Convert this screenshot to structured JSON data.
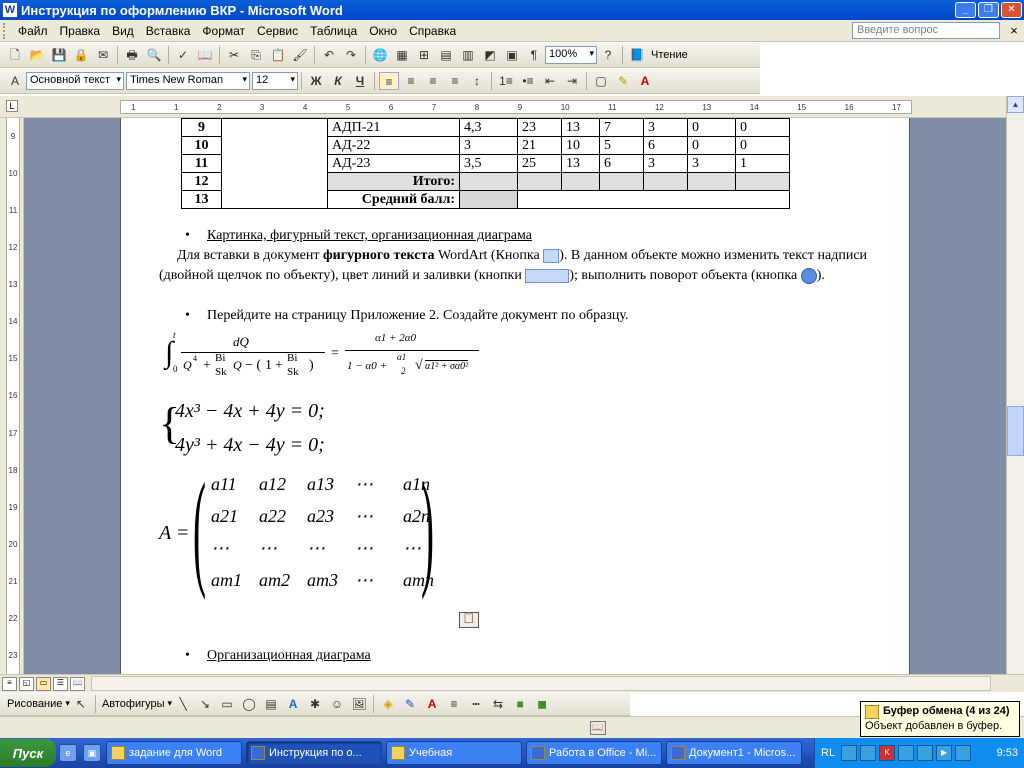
{
  "window": {
    "title": "Инструкция по оформлению ВКР - Microsoft Word",
    "app_icon": "W"
  },
  "menu": {
    "items": [
      "Файл",
      "Правка",
      "Вид",
      "Вставка",
      "Формат",
      "Сервис",
      "Таблица",
      "Окно",
      "Справка"
    ],
    "ask_placeholder": "Введите вопрос",
    "close_doc": "×"
  },
  "toolbar_standard": {
    "zoom": "100%",
    "reading_label": "Чтение"
  },
  "toolbar_format": {
    "style": "Основной текст",
    "font": "Times New Roman",
    "size": "12",
    "bold": "Ж",
    "italic": "К",
    "underline": "Ч"
  },
  "ruler": {
    "h_ticks": [
      "1",
      "1",
      "2",
      "3",
      "4",
      "5",
      "6",
      "7",
      "8",
      "9",
      "10",
      "11",
      "12",
      "13",
      "14",
      "15",
      "16",
      "17"
    ],
    "v_ticks": [
      "9",
      "10",
      "11",
      "12",
      "13",
      "14",
      "15",
      "16",
      "17",
      "18",
      "19",
      "20",
      "21",
      "22",
      "23"
    ]
  },
  "table": {
    "rows": [
      {
        "num": "9",
        "col2": "",
        "group": "АДП-21",
        "v1": "4,3",
        "v2": "23",
        "v3": "13",
        "v4": "7",
        "v5": "3",
        "v6": "0",
        "v7": "0"
      },
      {
        "num": "10",
        "col2": "",
        "group": "АД-22",
        "v1": "3",
        "v2": "21",
        "v3": "10",
        "v4": "5",
        "v5": "6",
        "v6": "0",
        "v7": "0"
      },
      {
        "num": "11",
        "col2": "",
        "group": "АД-23",
        "v1": "3,5",
        "v2": "25",
        "v3": "13",
        "v4": "6",
        "v5": "3",
        "v6": "3",
        "v7": "1"
      }
    ],
    "total_num": "12",
    "total_label": "Итого:",
    "avg_num": "13",
    "avg_label": "Средний балл:"
  },
  "content": {
    "bullet1": "Картинка, фигурный текст, организационная диаграма",
    "para1_a": "Для вставки в документ ",
    "para1_b": "фигурного текста",
    "para1_c": " WordArt (Кнопка ",
    "para1_d": "). В данном объекте можно изменить текст надписи (двойной щелчок по объекту), цвет линий и заливки (кнопки ",
    "para1_e": "); выполнить поворот объекта (кнопка ",
    "para1_f": ").",
    "bullet2": "Перейдите на страницу Приложение 2. Создайте документ по образцу.",
    "bullet3": "Организационная диаграма"
  },
  "formula": {
    "integral_upper": "t",
    "integral_lower": "0",
    "dq": "dQ",
    "q4": "Q",
    "bi": "Bi",
    "sk": "Sk",
    "q": "Q",
    "one": "1",
    "rhs_num": "α1 + 2α0",
    "rhs_den_a": "1 − α0 + ",
    "rhs_den_frac_n": "α1",
    "rhs_den_frac_d": "2",
    "rhs_den_sqrt": "α1² + σα0²"
  },
  "system": {
    "line1": "4x³ − 4x + 4y = 0;",
    "line2": "4y³ + 4x − 4y = 0;"
  },
  "matrix": {
    "lhs": "A =",
    "rows": [
      [
        "a11",
        "a12",
        "a13",
        "⋯",
        "a1n"
      ],
      [
        "a21",
        "a22",
        "a23",
        "⋯",
        "a2n"
      ],
      [
        "⋯",
        "⋯",
        "⋯",
        "⋯",
        "⋯"
      ],
      [
        "am1",
        "am2",
        "am3",
        "⋯",
        "amn"
      ]
    ]
  },
  "drawing_toolbar": {
    "draw_label": "Рисование",
    "autoshapes_label": "Автофигуры"
  },
  "clipboard_balloon": {
    "title": "Буфер обмена (4 из 24)",
    "message": "Объект добавлен в буфер."
  },
  "taskbar": {
    "start_label": "Пуск",
    "tasks": [
      {
        "label": "задание для Word",
        "active": false
      },
      {
        "label": "Инструкция по о...",
        "active": true
      },
      {
        "label": "Учебная",
        "active": false
      },
      {
        "label": "Работа в Office - Mi...",
        "active": false
      },
      {
        "label": "Документ1 - Micros...",
        "active": false
      }
    ],
    "lang": "RL",
    "clock": "9:53"
  }
}
